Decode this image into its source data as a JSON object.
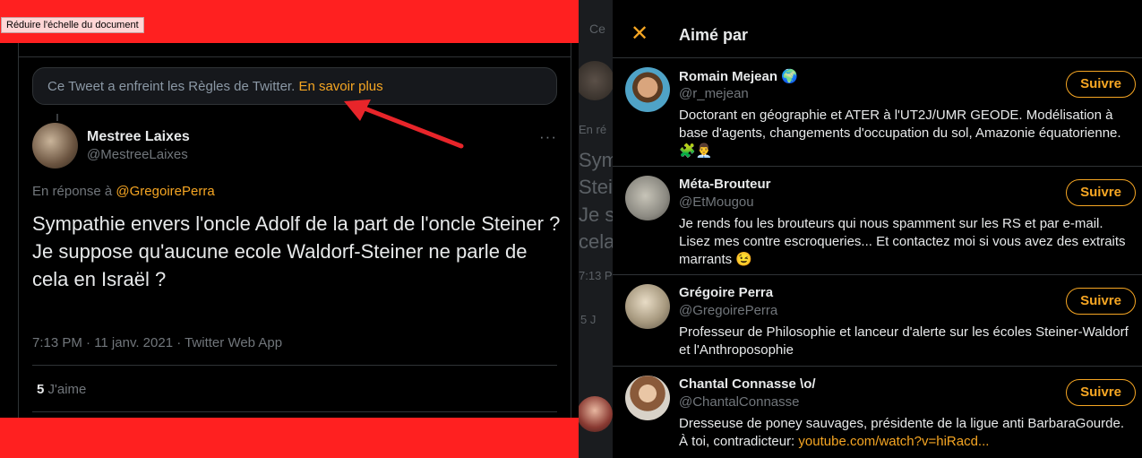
{
  "zoom_tooltip": "Réduire l'échelle du document",
  "tweet": {
    "violation_text": "Ce Tweet a enfreint les Règles de Twitter.",
    "violation_link": "En savoir plus",
    "author_name": "Mestree Laixes",
    "author_handle": "@MestreeLaixes",
    "more_icon": "···",
    "reply_prefix": "En réponse à",
    "reply_mention": "@GregoirePerra",
    "text_line1": "Sympathie envers l'oncle Adolf de la part de l'oncle Steiner ?",
    "text_line2": "Je suppose qu'aucune ecole Waldorf-Steiner ne parle de cela en Israël ?",
    "meta": "7:13 PM · 11 janv. 2021 · Twitter Web App",
    "likes_count": "5",
    "likes_label": "J'aime"
  },
  "background_fragments": {
    "top": "Ce",
    "reply": "En ré",
    "lines": [
      "Sym",
      "Stei",
      "Je s",
      "cela"
    ],
    "time": "7:13 P",
    "likes": "5 J"
  },
  "modal": {
    "title": "Aimé par",
    "close_icon": "✕",
    "follow_label": "Suivre",
    "users": [
      {
        "name": "Romain Mejean",
        "name_emoji": "🌍",
        "handle": "@r_mejean",
        "bio": "Doctorant en géographie et ATER à l'UT2J/UMR GEODE. Modélisation à base d'agents, changements d'occupation du sol, Amazonie équatorienne. 🧩👨‍💼"
      },
      {
        "name": "Méta-Brouteur",
        "handle": "@EtMougou",
        "bio": "Je rends fou les brouteurs qui nous spamment sur les RS et par e-mail. Lisez mes contre escroqueries... Et contactez moi si vous avez des extraits marrants 😉"
      },
      {
        "name": "Grégoire Perra",
        "handle": "@GregoirePerra",
        "bio": "Professeur de Philosophie et lanceur d'alerte sur les écoles Steiner-Waldorf et l'Anthroposophie"
      },
      {
        "name": "Chantal Connasse \\o/",
        "handle": "@ChantalConnasse",
        "bio_text": "Dresseuse de poney sauvages, présidente de la ligue anti BarbaraGourde. À toi, contradicteur:",
        "bio_link": "youtube.com/watch?v=hiRacd..."
      }
    ]
  },
  "colors": {
    "accent": "#f6a623",
    "red_overlay": "#ff2020",
    "arrow": "#e8252a"
  }
}
